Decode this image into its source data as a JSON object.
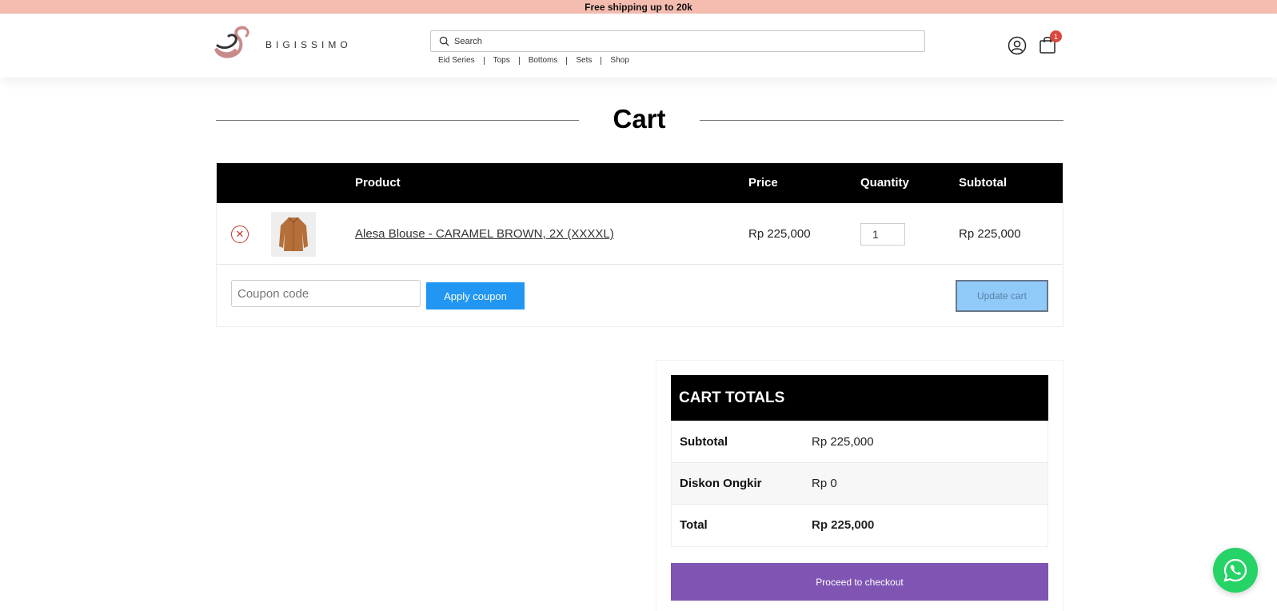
{
  "promo": {
    "text": "Free shipping up to 20k"
  },
  "header": {
    "logo_text": "BIGISSIMO",
    "search_placeholder": "Search",
    "nav": [
      "Eid Series",
      "Tops",
      "Bottoms",
      "Sets",
      "Shop"
    ],
    "cart_count": "1"
  },
  "page": {
    "title": "Cart"
  },
  "cart": {
    "headers": {
      "product": "Product",
      "price": "Price",
      "quantity": "Quantity",
      "subtotal": "Subtotal"
    },
    "items": [
      {
        "name": "Alesa Blouse - CARAMEL BROWN, 2X (XXXXL)",
        "price": "Rp 225,000",
        "quantity": "1",
        "subtotal": "Rp 225,000"
      }
    ],
    "coupon_placeholder": "Coupon code",
    "apply_label": "Apply coupon",
    "update_label": "Update cart"
  },
  "totals": {
    "heading": "CART TOTALS",
    "rows": [
      {
        "label": "Subtotal",
        "value": "Rp 225,000"
      },
      {
        "label": "Diskon Ongkir",
        "value": "Rp 0"
      },
      {
        "label": "Total",
        "value": "Rp 225,000"
      }
    ],
    "checkout_label": "Proceed to checkout"
  },
  "colors": {
    "promo_bg": "#f5bcb0",
    "apply_button": "#2196f3",
    "checkout_button": "#7f54b3",
    "whatsapp": "#25d366"
  }
}
